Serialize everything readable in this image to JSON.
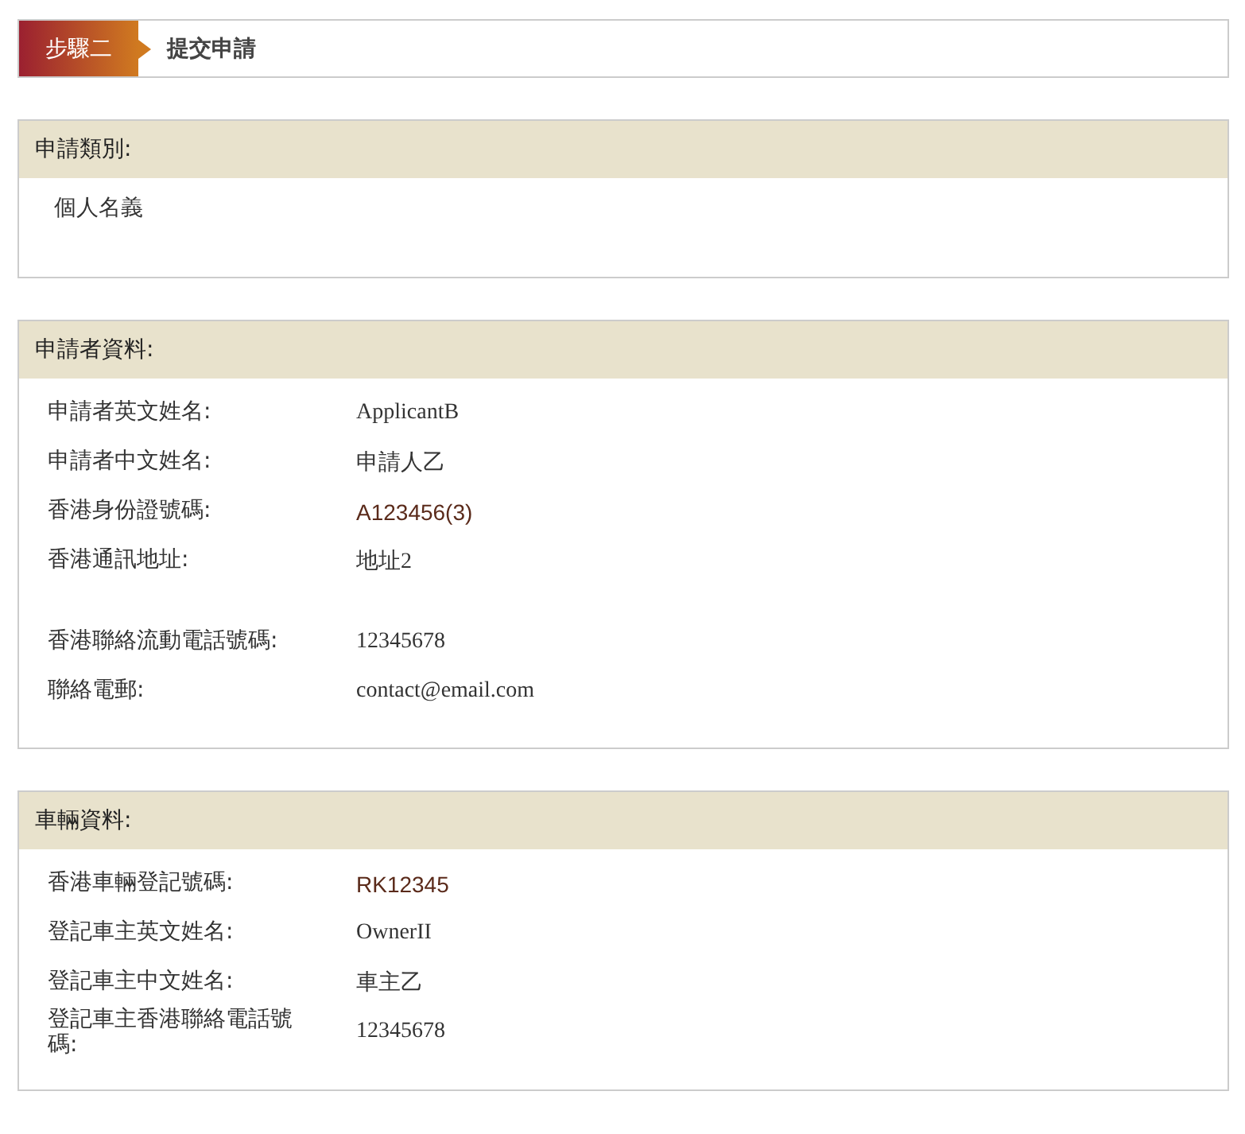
{
  "step": {
    "badge": "步驟二",
    "title": "提交申請"
  },
  "sections": [
    {
      "heading": "申請類別:",
      "kind": "note",
      "text": "個人名義"
    },
    {
      "heading": "申請者資料:",
      "kind": "fields",
      "fields": [
        {
          "label": "申請者英文姓名:",
          "value": "ApplicantB",
          "kind": "plain"
        },
        {
          "label": "申請者中文姓名:",
          "value": "申請人乙",
          "kind": "plain"
        },
        {
          "label": "香港身份證號碼:",
          "value": "A123456(3)",
          "kind": "code"
        },
        {
          "label": "香港通訊地址:",
          "value": "地址2",
          "kind": "address"
        },
        {
          "label": "香港聯絡流動電話號碼:",
          "value": "12345678",
          "kind": "plain"
        },
        {
          "label": "聯絡電郵:",
          "value": "contact@email.com",
          "kind": "plain"
        }
      ]
    },
    {
      "heading": "車輛資料:",
      "kind": "fields",
      "fields": [
        {
          "label": "香港車輛登記號碼:",
          "value": "RK12345",
          "kind": "code"
        },
        {
          "label": "登記車主英文姓名:",
          "value": "OwnerII",
          "kind": "plain"
        },
        {
          "label": "登記車主中文姓名:",
          "value": "車主乙",
          "kind": "plain"
        },
        {
          "label": "登記車主香港聯絡電話號碼:",
          "value": "12345678",
          "kind": "plain"
        }
      ]
    }
  ]
}
